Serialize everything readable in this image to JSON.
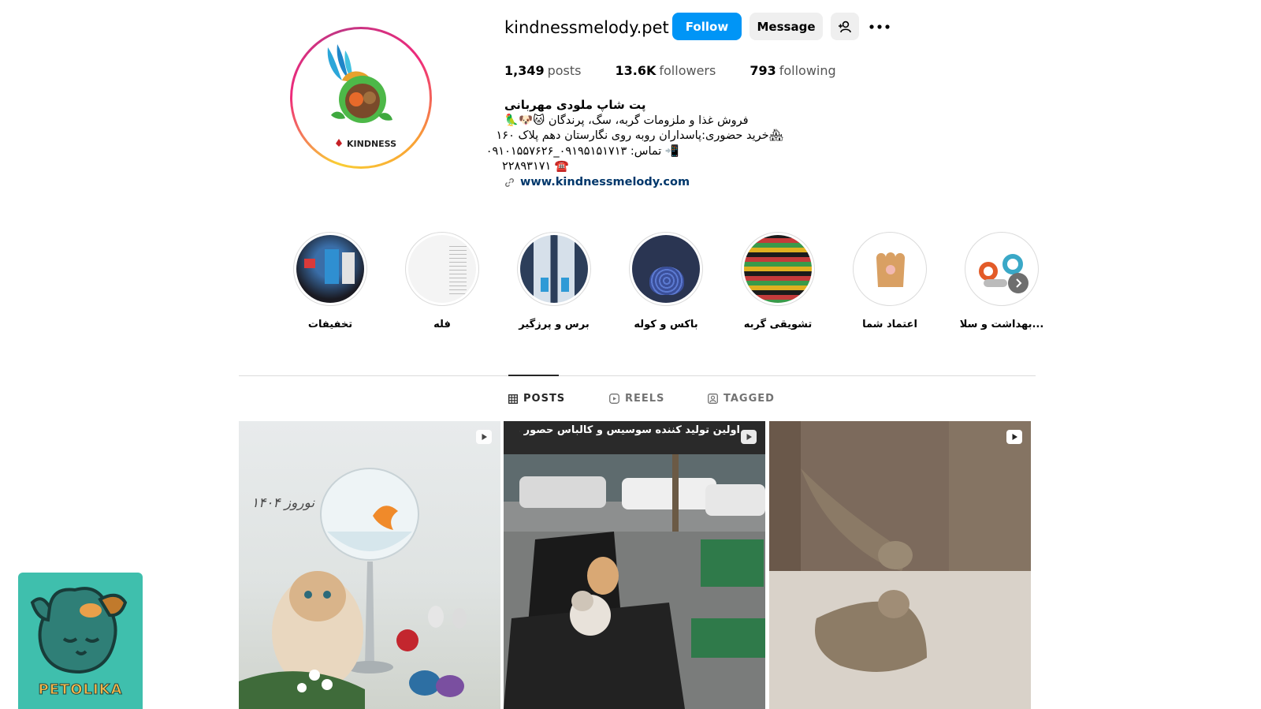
{
  "profile": {
    "username": "kindnessmelody.pet",
    "avatar_text": "KINDNESS",
    "follow_label": "Follow",
    "message_label": "Message",
    "stats": {
      "posts_count": "1,349",
      "posts_label": "posts",
      "followers_count": "13.6K",
      "followers_label": "followers",
      "following_count": "793",
      "following_label": "following"
    },
    "bio": {
      "name": "پت شاپ ملودی مهربانی",
      "line1": "فروش غذا و ملزومات گربه، سگ، پرندگان 🐱🐶🦜",
      "line2": "🏘خرید حضوری:پاسداران روبه روی نگارستان دهم پلاک ۱۶۰",
      "line3": "📲 تماس: ۰۹۱۹۵۱۵۱۷۱۳_۰۹۱۰۱۵۵۷۶۲۶",
      "line4": "☎️ ۲۲۸۹۳۱۷۱",
      "link": "www.kindnessmelody.com"
    }
  },
  "highlights": [
    {
      "label": "تخفیفات"
    },
    {
      "label": "فله"
    },
    {
      "label": "برس و پرزگیر"
    },
    {
      "label": "باکس و کوله"
    },
    {
      "label": "تشویقی گربه"
    },
    {
      "label": "اعتماد شما"
    },
    {
      "label": "بهداشت و سلا..."
    }
  ],
  "tabs": {
    "posts": "POSTS",
    "reels": "REELS",
    "tagged": "TAGGED"
  },
  "posts": [
    {
      "overlay_text": "نوروز ۱۴۰۴"
    },
    {
      "overlay_text": "اولین تولید کننده سوسیس و کالباس حصور مشتری"
    },
    {
      "overlay_text": ""
    }
  ],
  "watermark": {
    "text": "PETOLIKA"
  },
  "colors": {
    "accent": "#0095f6",
    "link": "#00376b",
    "watermark_bg": "#3fbfad"
  }
}
